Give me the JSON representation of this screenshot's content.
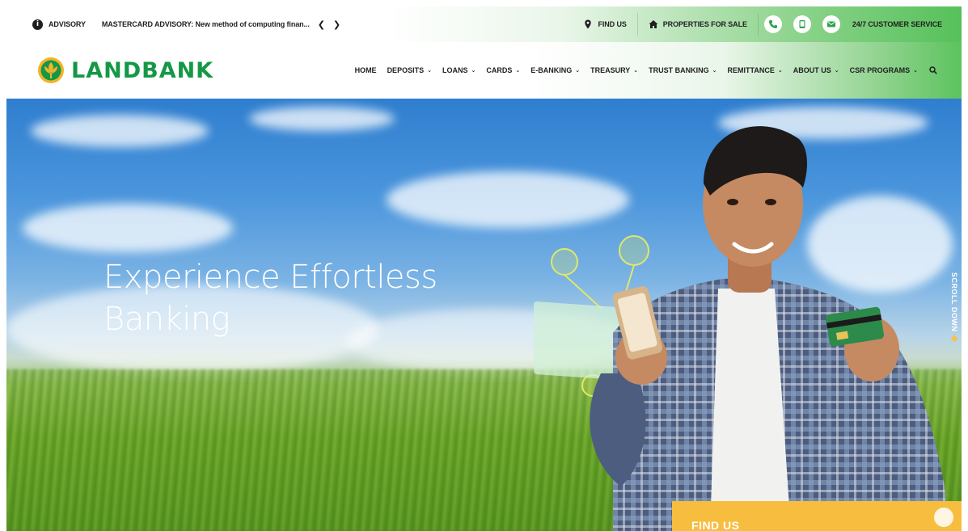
{
  "topbar": {
    "advisory_icon": "info-icon",
    "advisory_label": "ADVISORY",
    "advisory_text": "MASTERCARD ADVISORY: New method of computing finan...",
    "find_us": "FIND US",
    "properties": "PROPERTIES FOR SALE",
    "customer_service": "24/7 CUSTOMER SERVICE"
  },
  "nav": {
    "brand": "LANDBANK",
    "items": [
      {
        "label": "HOME",
        "dropdown": false
      },
      {
        "label": "DEPOSITS",
        "dropdown": true
      },
      {
        "label": "LOANS",
        "dropdown": true
      },
      {
        "label": "CARDS",
        "dropdown": true
      },
      {
        "label": "E-BANKING",
        "dropdown": true
      },
      {
        "label": "TREASURY",
        "dropdown": true
      },
      {
        "label": "TRUST BANKING",
        "dropdown": true
      },
      {
        "label": "REMITTANCE",
        "dropdown": true
      },
      {
        "label": "ABOUT US",
        "dropdown": true
      },
      {
        "label": "CSR PROGRAMS",
        "dropdown": true
      }
    ]
  },
  "hero": {
    "title_line1": "Experience Effortless",
    "title_line2": "Banking",
    "scroll_down": "SCROLL DOWN",
    "find_us_panel": "FIND US"
  },
  "colors": {
    "brand_green": "#149846",
    "accent_yellow": "#f6bd3f"
  }
}
